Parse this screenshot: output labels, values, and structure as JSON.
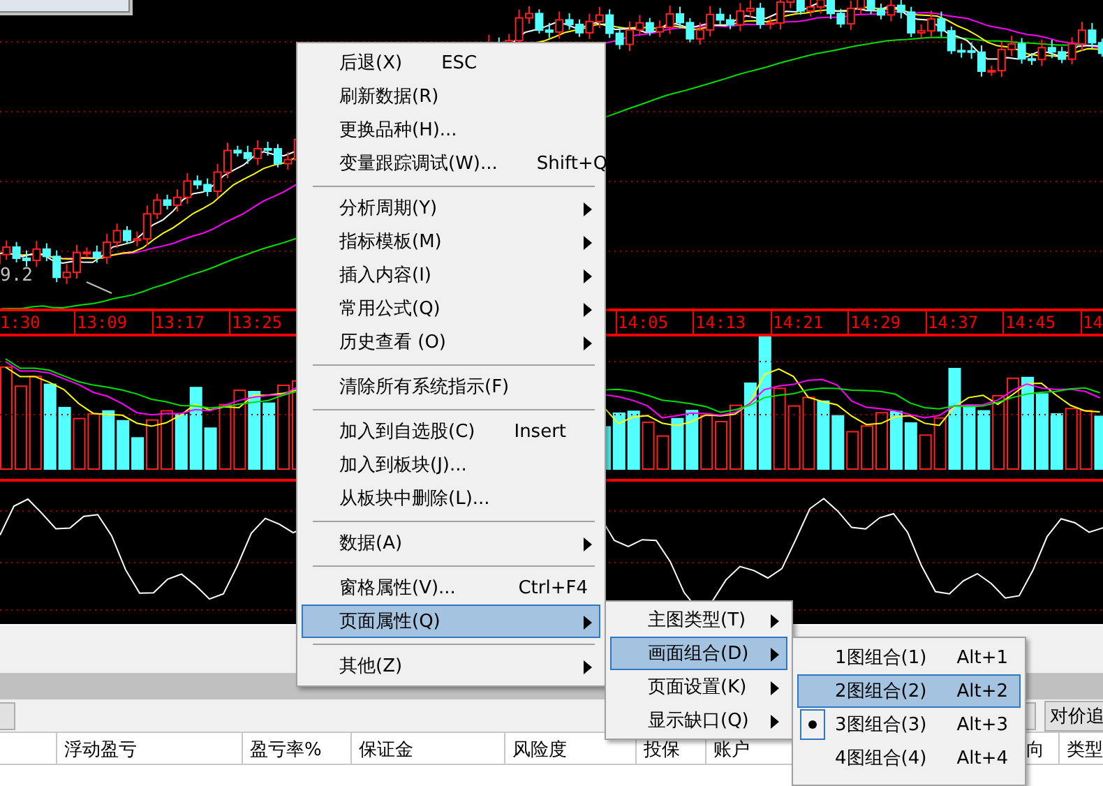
{
  "price_chart": {
    "price_label": "9.2"
  },
  "time_axis": {
    "left_labels": [
      "1:30",
      "13:09",
      "13:17",
      "13:25"
    ],
    "right_labels": [
      "14:05",
      "14:13",
      "14:21",
      "14:29",
      "14:37",
      "14:45",
      "14"
    ]
  },
  "context_menu": {
    "items": [
      {
        "kind": "item",
        "label": "后退(X)",
        "shortcut": "ESC",
        "selected": false
      },
      {
        "kind": "item",
        "label": "刷新数据(R)",
        "selected": false
      },
      {
        "kind": "item",
        "label": "更换品种(H)...",
        "selected": false
      },
      {
        "kind": "item",
        "label": "变量跟踪调试(W)...",
        "shortcut": "Shift+Q",
        "selected": false
      },
      {
        "kind": "separator"
      },
      {
        "kind": "submenu",
        "label": "分析周期(Y)",
        "selected": false
      },
      {
        "kind": "submenu",
        "label": "指标模板(M)",
        "selected": false
      },
      {
        "kind": "submenu",
        "label": "插入内容(I)",
        "selected": false
      },
      {
        "kind": "submenu",
        "label": "常用公式(Q)",
        "selected": false
      },
      {
        "kind": "submenu",
        "label": "历史查看 (O)",
        "selected": false
      },
      {
        "kind": "separator"
      },
      {
        "kind": "item",
        "label": "清除所有系统指示(F)",
        "selected": false
      },
      {
        "kind": "separator"
      },
      {
        "kind": "item",
        "label": "加入到自选股(C)",
        "shortcut": "Insert",
        "selected": false
      },
      {
        "kind": "item",
        "label": "加入到板块(J)...",
        "selected": false
      },
      {
        "kind": "item",
        "label": "从板块中删除(L)...",
        "selected": false
      },
      {
        "kind": "separator"
      },
      {
        "kind": "submenu",
        "label": "数据(A)",
        "selected": false
      },
      {
        "kind": "separator"
      },
      {
        "kind": "item",
        "label": "窗格属性(V)...",
        "shortcut": "Ctrl+F4",
        "selected": false
      },
      {
        "kind": "submenu",
        "label": "页面属性(Q)",
        "selected": true
      },
      {
        "kind": "separator"
      },
      {
        "kind": "submenu",
        "label": "其他(Z)",
        "selected": false
      }
    ]
  },
  "page_submenu": {
    "items": [
      {
        "label": "主图类型(T)",
        "selected": false
      },
      {
        "label": "画面组合(D)",
        "selected": true
      },
      {
        "label": "页面设置(K)",
        "selected": false
      },
      {
        "label": "显示缺口(Q)",
        "selected": false
      }
    ]
  },
  "layout_submenu": {
    "items": [
      {
        "label": "1图组合(1)",
        "shortcut": "Alt+1",
        "selected": false,
        "checked": false
      },
      {
        "label": "2图组合(2)",
        "shortcut": "Alt+2",
        "selected": true,
        "checked": false
      },
      {
        "label": "3图组合(3)",
        "shortcut": "Alt+3",
        "selected": false,
        "checked": true
      },
      {
        "label": "4图组合(4)",
        "shortcut": "Alt+4",
        "selected": false,
        "checked": false
      }
    ]
  },
  "toolbar": {
    "buttons": [
      "对价追"
    ]
  },
  "positions_table": {
    "columns": [
      "浮动盈亏",
      "盈亏率%",
      "保证金",
      "风险度",
      "投保",
      "账户"
    ],
    "right_columns": [
      "向",
      "类型"
    ]
  }
}
